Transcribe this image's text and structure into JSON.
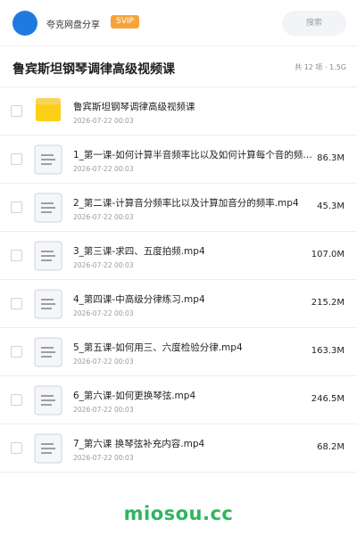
{
  "header": {
    "username": "夸克网盘分享",
    "badge": "SVIP",
    "search_label": "搜索",
    "colors": {
      "avatar": "#1f7ae0",
      "badge": "#f6a43a"
    }
  },
  "folder_title": "鲁宾斯坦钢琴调律高级视频课",
  "meta": "共 12 项 · 1.5G",
  "items": [
    {
      "type": "folder",
      "icon": "folder-icon",
      "name": "鲁宾斯坦钢琴调律高级视频课",
      "date": "2026-07-22 00:03",
      "size": ""
    },
    {
      "type": "file",
      "icon": "document-icon",
      "name": "1_第一课-如何计算半音频率比以及如何计算每个音的频率.mp4",
      "date": "2026-07-22 00:03",
      "size": "86.3M"
    },
    {
      "type": "file",
      "icon": "document-icon",
      "name": "2_第二课-计算音分频率比以及计算加音分的频率.mp4",
      "date": "2026-07-22 00:03",
      "size": "45.3M"
    },
    {
      "type": "file",
      "icon": "document-icon",
      "name": "3_第三课-求四、五度拍频.mp4",
      "date": "2026-07-22 00:03",
      "size": "107.0M"
    },
    {
      "type": "file",
      "icon": "document-icon",
      "name": "4_第四课-中高级分律练习.mp4",
      "date": "2026-07-22 00:03",
      "size": "215.2M"
    },
    {
      "type": "file",
      "icon": "document-icon",
      "name": "5_第五课-如何用三、六度检验分律.mp4",
      "date": "2026-07-22 00:03",
      "size": "163.3M"
    },
    {
      "type": "file",
      "icon": "document-icon",
      "name": "6_第六课-如何更换琴弦.mp4",
      "date": "2026-07-22 00:03",
      "size": "246.5M"
    },
    {
      "type": "file",
      "icon": "document-icon",
      "name": "7_第六课 换琴弦补充内容.mp4",
      "date": "2026-07-22 00:03",
      "size": "68.2M"
    }
  ],
  "watermark": "miosou.cc"
}
